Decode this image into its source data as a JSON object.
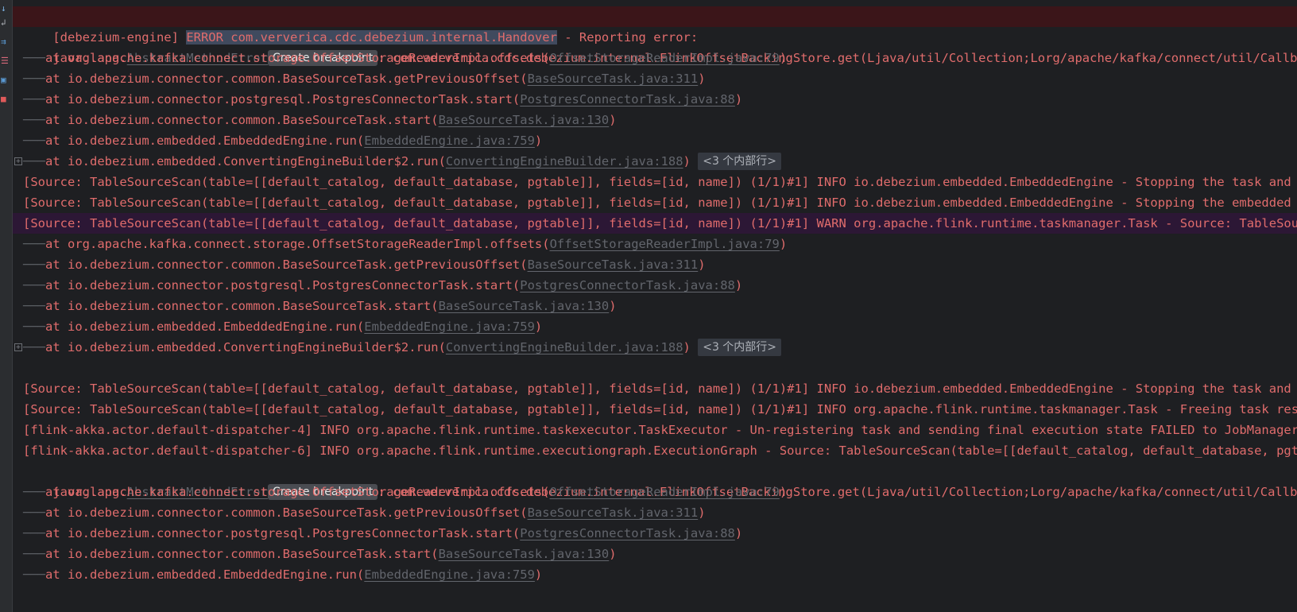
{
  "gutter_icons": [
    {
      "name": "step-over-icon",
      "glyph": "↓",
      "color": "#7fb6e8"
    },
    {
      "name": "soft-wrap-icon",
      "glyph": "↲",
      "color": "#aeb2b9"
    },
    {
      "name": "scroll-to-end-icon",
      "glyph": "⇉",
      "color": "#5b9bd5"
    },
    {
      "name": "filter-icon",
      "glyph": "☰",
      "color": "#d9697a"
    },
    {
      "name": "print-icon",
      "glyph": "▣",
      "color": "#5b9bd5"
    },
    {
      "name": "clear-all-icon",
      "glyph": "■",
      "color": "#e05a5a"
    }
  ],
  "console": {
    "line01": {
      "prefix": "[debezium-engine] ",
      "selected": "ERROR com.ververica.cdc.debezium.internal.Handover",
      "rest": " - Reporting error:"
    },
    "line02": {
      "pre": "java.lang.",
      "link": "AbstractMethodError",
      "tooltip": "Create breakpoint",
      "post": ": com.ververica.cdc.debezium.internal.FlinkOffsetBackingStore.get(Ljava/util/Collection;Lorg/apache/kafka/connect/util/Callback;)Ljava/util/concurrent/Future;"
    },
    "line03": {
      "text": "at org.apache.kafka.connect.storage.OffsetStorageReaderImpl.offsets(",
      "link": "OffsetStorageReaderImpl.java:79",
      "post": ")"
    },
    "line04": {
      "text": "at io.debezium.connector.common.BaseSourceTask.getPreviousOffset(",
      "link": "BaseSourceTask.java:311",
      "post": ")"
    },
    "line05": {
      "text": "at io.debezium.connector.postgresql.PostgresConnectorTask.start(",
      "link": "PostgresConnectorTask.java:88",
      "post": ")"
    },
    "line06": {
      "text": "at io.debezium.connector.common.BaseSourceTask.start(",
      "link": "BaseSourceTask.java:130",
      "post": ")"
    },
    "line07": {
      "text": "at io.debezium.embedded.EmbeddedEngine.run(",
      "link": "EmbeddedEngine.java:759",
      "post": ")"
    },
    "line08": {
      "text": "at io.debezium.embedded.ConvertingEngineBuilder$2.run(",
      "link": "ConvertingEngineBuilder.java:188",
      "post": ") ",
      "chip": "<3 个内部行>"
    },
    "line09": {
      "text": "[Source: TableSourceScan(table=[[default_catalog, default_database, pgtable]], fields=[id, name]) (1/1)#1] INFO io.debezium.embedded.EmbeddedEngine - Stopping the task and engine"
    },
    "line10": {
      "text": "[Source: TableSourceScan(table=[[default_catalog, default_database, pgtable]], fields=[id, name]) (1/1)#1] INFO io.debezium.embedded.EmbeddedEngine - Stopping the embedded engine"
    },
    "line11": {
      "text": "[Source: TableSourceScan(table=[[default_catalog, default_database, pgtable]], fields=[id, name]) (1/1)#1] WARN org.apache.flink.runtime.taskmanager.Task - Source: TableSourceScan"
    },
    "line12": {
      "text": "at org.apache.kafka.connect.storage.OffsetStorageReaderImpl.offsets(",
      "link": "OffsetStorageReaderImpl.java:79",
      "post": ")"
    },
    "line13": {
      "text": "at io.debezium.connector.common.BaseSourceTask.getPreviousOffset(",
      "link": "BaseSourceTask.java:311",
      "post": ")"
    },
    "line14": {
      "text": "at io.debezium.connector.postgresql.PostgresConnectorTask.start(",
      "link": "PostgresConnectorTask.java:88",
      "post": ")"
    },
    "line15": {
      "text": "at io.debezium.connector.common.BaseSourceTask.start(",
      "link": "BaseSourceTask.java:130",
      "post": ")"
    },
    "line16": {
      "text": "at io.debezium.embedded.EmbeddedEngine.run(",
      "link": "EmbeddedEngine.java:759",
      "post": ")"
    },
    "line17": {
      "text": "at io.debezium.embedded.ConvertingEngineBuilder$2.run(",
      "link": "ConvertingEngineBuilder.java:188",
      "post": ") ",
      "chip": "<3 个内部行>"
    },
    "line19": {
      "text": "[Source: TableSourceScan(table=[[default_catalog, default_database, pgtable]], fields=[id, name]) (1/1)#1] INFO io.debezium.embedded.EmbeddedEngine - Stopping the task and engine"
    },
    "line20": {
      "text": "[Source: TableSourceScan(table=[[default_catalog, default_database, pgtable]], fields=[id, name]) (1/1)#1] INFO org.apache.flink.runtime.taskmanager.Task - Freeing task resources"
    },
    "line21": {
      "text": "[flink-akka.actor.default-dispatcher-4] INFO org.apache.flink.runtime.taskexecutor.TaskExecutor - Un-registering task and sending final execution state FAILED to JobManager"
    },
    "line22": {
      "text": "[flink-akka.actor.default-dispatcher-6] INFO org.apache.flink.runtime.executiongraph.ExecutionGraph - Source: TableSourceScan(table=[[default_catalog, default_database, pgtable]]"
    },
    "line23": {
      "pre": "java.lang.",
      "link": "AbstractMethodError",
      "tooltip": "Create breakpoint",
      "post": ": com.ververica.cdc.debezium.internal.FlinkOffsetBackingStore.get(Ljava/util/Collection;Lorg/apache/kafka/connect/util/Callback;)Ljava/util/concurrent/Future;"
    },
    "line24": {
      "text": "at org.apache.kafka.connect.storage.OffsetStorageReaderImpl.offsets(",
      "link": "OffsetStorageReaderImpl.java:79",
      "post": ")"
    },
    "line25": {
      "text": "at io.debezium.connector.common.BaseSourceTask.getPreviousOffset(",
      "link": "BaseSourceTask.java:311",
      "post": ")"
    },
    "line26": {
      "text": "at io.debezium.connector.postgresql.PostgresConnectorTask.start(",
      "link": "PostgresConnectorTask.java:88",
      "post": ")"
    },
    "line27": {
      "text": "at io.debezium.connector.common.BaseSourceTask.start(",
      "link": "BaseSourceTask.java:130",
      "post": ")"
    },
    "line28": {
      "text": "at io.debezium.embedded.EmbeddedEngine.run(",
      "link": "EmbeddedEngine.java:759",
      "post": ")"
    }
  },
  "colors": {
    "error_text": "#e06c6c",
    "link": "#62656c",
    "error_highlight": "#3b1519",
    "warn_highlight": "#2c1735",
    "background": "#1e1f22"
  }
}
